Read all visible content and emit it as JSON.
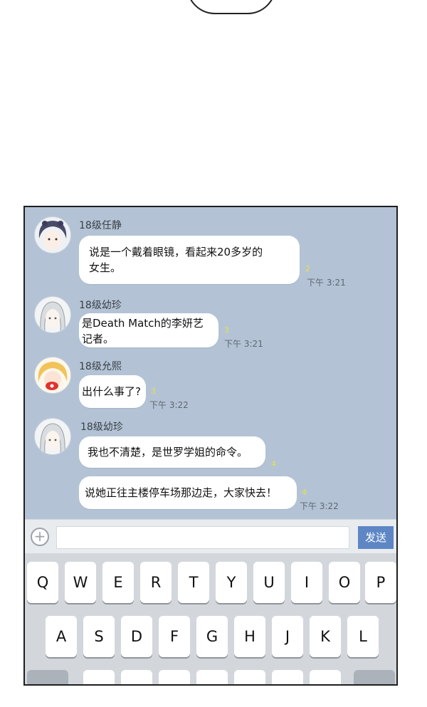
{
  "messages": [
    {
      "sender": "18级任静",
      "lines": [
        "说是一个戴着眼镜，看起来20多岁的",
        "女生。"
      ],
      "count": "2",
      "time": "下午 3:21"
    },
    {
      "sender": "18级幼珍",
      "lines": [
        "是Death Match的李妍艺",
        "记者。"
      ],
      "count": "3",
      "time": "下午 3:21"
    },
    {
      "sender": "18级允熙",
      "lines": [
        "出什么事了?"
      ],
      "count": "3",
      "time": "下午 3:22"
    },
    {
      "sender": "18级幼珍",
      "lines": [
        "我也不清楚，是世罗学姐的命令。"
      ],
      "count": "4",
      "time": ""
    },
    {
      "sender": "",
      "lines": [
        "说她正往主楼停车场那边走，大家快去！"
      ],
      "count": "4",
      "time": "下午 3:22"
    }
  ],
  "input": {
    "plus_icon": "plus-circle-icon",
    "value": "",
    "send_label": "发送"
  },
  "keyboard": {
    "row1": [
      "Q",
      "W",
      "E",
      "R",
      "T",
      "Y",
      "U",
      "I",
      "O",
      "P"
    ],
    "row2": [
      "A",
      "S",
      "D",
      "F",
      "G",
      "H",
      "J",
      "K",
      "L"
    ]
  },
  "colors": {
    "chat_bg": "#b3c3d5",
    "send_button": "#5e86c5",
    "read_count": "#e8e04a"
  }
}
